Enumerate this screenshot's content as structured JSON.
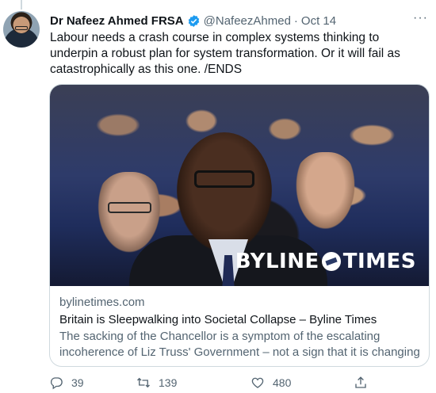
{
  "tweet": {
    "author_name": "Dr Nafeez Ahmed FRSA",
    "handle": "@NafeezAhmed",
    "separator": "·",
    "date": "Oct 14",
    "more_label": "···",
    "text": "Labour needs a crash course in complex systems thinking to underpin a robust plan for system transformation. Or it will fail as catastrophically as this one. /ENDS"
  },
  "card": {
    "brand_left": "BYLINE",
    "brand_right": "TIMES",
    "domain": "bylinetimes.com",
    "title": "Britain is Sleepwalking into Societal Collapse – Byline Times",
    "description": "The sacking of the Chancellor is a symptom of the escalating incoherence of Liz Truss' Government – not a sign that it is changing ..."
  },
  "actions": {
    "replies": "39",
    "retweets": "139",
    "likes": "480"
  },
  "colors": {
    "verified": "#1d9bf0",
    "secondary_text": "#536471",
    "border": "#cfd9de"
  },
  "icons": [
    "verified-badge-icon",
    "more-icon",
    "reply-icon",
    "retweet-icon",
    "like-icon",
    "share-icon"
  ]
}
